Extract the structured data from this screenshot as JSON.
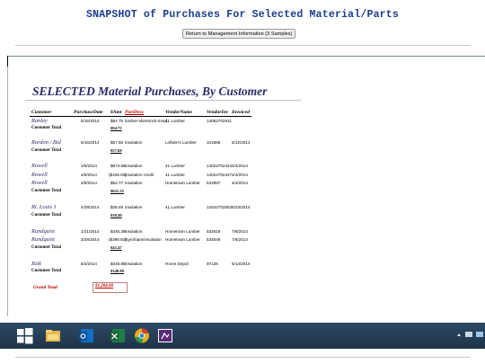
{
  "page": {
    "title": "SNAPSHOT of Purchases For Selected Material/Parts",
    "return_button": "Return to Management Information (3 Samples)"
  },
  "report": {
    "title": "SELECTED Material Purchases, By Customer",
    "headers": {
      "customer": "Customer",
      "purchase_date": "PurchaseDate",
      "amount": "$Amt",
      "part_desc": "PartDesc",
      "vendor_name": "VendorName",
      "vendor_inv": "VendorInv",
      "invoiced": "Invoiced"
    },
    "customer_total_label": "Customer Total",
    "groups": [
      {
        "rows": [
          {
            "customer": "Ranley",
            "date": "5/15/2014",
            "amt": "$94.75",
            "desc": "lumber-sheetrock-insul.",
            "vendor": "41 Lumber",
            "inv": "14052702811",
            "invoiced": ""
          }
        ],
        "total": "$94.75"
      },
      {
        "rows": [
          {
            "customer": "Rardon / Bid",
            "date": "5/16/2014",
            "amt": "$57.68",
            "desc": "insulation",
            "vendor": "Loftwin's Lumber",
            "inv": "101868",
            "invoiced": "6/12/2014"
          }
        ],
        "total": "$57.68"
      },
      {
        "rows": [
          {
            "customer": "Rowell",
            "date": "2/6/2014",
            "amt": "$674.58",
            "desc": "insulation",
            "vendor": "41 Lumber",
            "inv": "14022702424",
            "invoiced": "4/4/2014"
          },
          {
            "customer": "Rowell",
            "date": "2/6/2014",
            "amt": "($106.00)",
            "desc": "insulation credit",
            "vendor": "41 Lumber",
            "inv": "14022702427",
            "invoiced": "4/4/2014"
          },
          {
            "customer": "Rowell",
            "date": "2/6/2014",
            "amt": "$52.77",
            "desc": "insulation",
            "vendor": "Hometown Lumber",
            "inv": "532887",
            "invoiced": "4/4/2014"
          }
        ],
        "total": "$621.35"
      },
      {
        "rows": [
          {
            "customer": "Rt. Louis 1",
            "date": "4/28/2014",
            "amt": "$38.49",
            "desc": "insulation",
            "vendor": "41 Lumber",
            "inv": "14042702553",
            "invoiced": "6/23/2014"
          }
        ],
        "total": "$38.49"
      },
      {
        "rows": [
          {
            "customer": "Rundquist",
            "date": "1/21/2014",
            "amt": "$440.39",
            "desc": "insulation",
            "vendor": "Hometown Lumber",
            "inv": "532618",
            "invoiced": "7/8/2014"
          },
          {
            "customer": "Rundquist",
            "date": "3/29/2014",
            "amt": "($398.92)",
            "desc": "styrofoam/insulation",
            "vendor": "Hometown Lumber",
            "inv": "534646",
            "invoiced": "7/8/2014"
          }
        ],
        "total": "$43.47"
      },
      {
        "rows": [
          {
            "customer": "Rzik",
            "date": "6/2/2014",
            "amt": "$348.88",
            "desc": "insulation",
            "vendor": "Home Depot",
            "inv": "97135",
            "invoiced": "6/14/2014"
          }
        ],
        "total": "$348.88"
      }
    ],
    "grand_total_label": "Grand Total",
    "grand_total": "$1,204.90"
  },
  "taskbar": {
    "start_icon": "windows-start-icon",
    "apps": [
      "file-explorer-icon",
      "outlook-icon",
      "excel-icon",
      "chrome-icon",
      "media-app-icon"
    ],
    "colors": {
      "explorer": "#e8b64a",
      "outlook": "#0f6fc6",
      "excel": "#1e7e45",
      "chrome": "#e0b020",
      "media": "#5a2a7a"
    }
  }
}
